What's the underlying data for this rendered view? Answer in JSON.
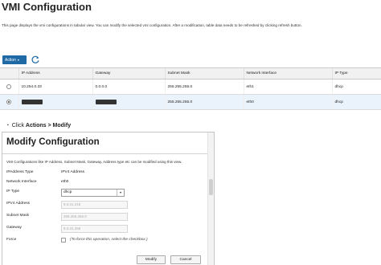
{
  "page": {
    "title": "VMI Configuration",
    "description": "This page displays the vmi configurations in tabular view. You can modify the selected vmi configuration. After a modification, table data needs to be refreshed by clicking refresh button."
  },
  "toolbar": {
    "action_label": "Action",
    "action_caret": "▾",
    "refresh_icon": "refresh-icon"
  },
  "table": {
    "headers": [
      "",
      "IP Address",
      "Gateway",
      "Subnet Mask",
      "Network Interface",
      "IP Type"
    ],
    "rows": [
      {
        "selected": false,
        "ip": "10.254.0.33",
        "gateway": "0.0.0.0",
        "subnet": "255.255.255.0",
        "interface": "eth1",
        "ip_type": "dhcp"
      },
      {
        "selected": true,
        "ip": "",
        "gateway": "",
        "subnet": "255.255.255.0",
        "interface": "eth0",
        "ip_type": "dhcp"
      }
    ]
  },
  "instruction": {
    "bullet": "▪",
    "prefix": "Click ",
    "bold": "Actions > Modify"
  },
  "dialog": {
    "title": "Modify Configuration",
    "description": "VMI Configurations like IP Address, Subnet Mask, Gateway, Address type etc can be modified using this view.",
    "fields": {
      "ipaddress_type_label": "IPAddress Type",
      "ipaddress_type_value": "IPV4 Address",
      "network_interface_label": "Network Interface",
      "network_interface_value": "eth0",
      "ip_type_label": "IP Type",
      "ip_type_value": "dhcp",
      "ip_type_arrow": "▾",
      "ipv4_label": "IPV4 Address",
      "ipv4_placeholder": "9.3.31.216",
      "subnet_label": "Subnet Mask",
      "subnet_placeholder": "255.255.255.0",
      "gateway_label": "Gateway",
      "gateway_placeholder": "9.3.31.259",
      "force_label": "Force",
      "force_hint": "(To force this operation, select the checkbox.)"
    },
    "buttons": {
      "modify": "Modify",
      "cancel": "Cancel"
    }
  },
  "colors": {
    "accent": "#1f6aa5",
    "selected_row": "#eaf3fb"
  }
}
